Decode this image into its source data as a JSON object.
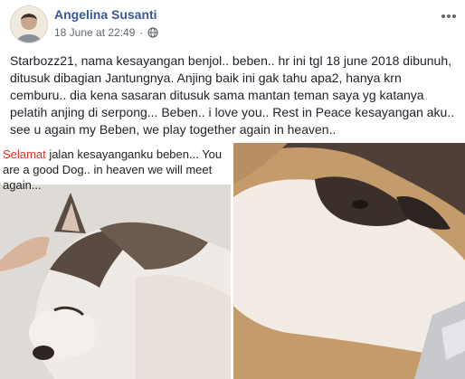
{
  "post": {
    "author": "Angelina Susanti",
    "timestamp": "18 June at 22:49",
    "separator": "·",
    "text": "Starbozz21, nama kesayangan benjol.. beben.. hr ini tgl 18 june 2018 dibunuh, ditusuk dibagian Jantungnya. Anjing baik ini gak tahu apa2, hanya krn cemburu.. dia kena sasaran ditusuk sama mantan teman saya yg katanya pelatih anjing di serpong... Beben.. i love you.. Rest in Peace kesayangan aku.. see u again my Beben, we play together again in heaven.."
  },
  "photo_left": {
    "caption_highlight": "Selamat",
    "caption_rest": " jalan kesayanganku beben... You are a good Dog.. in heaven we will meet again..."
  },
  "icons": {
    "globe": "globe-icon",
    "more": "more-options-icon",
    "avatar": "profile-avatar"
  }
}
